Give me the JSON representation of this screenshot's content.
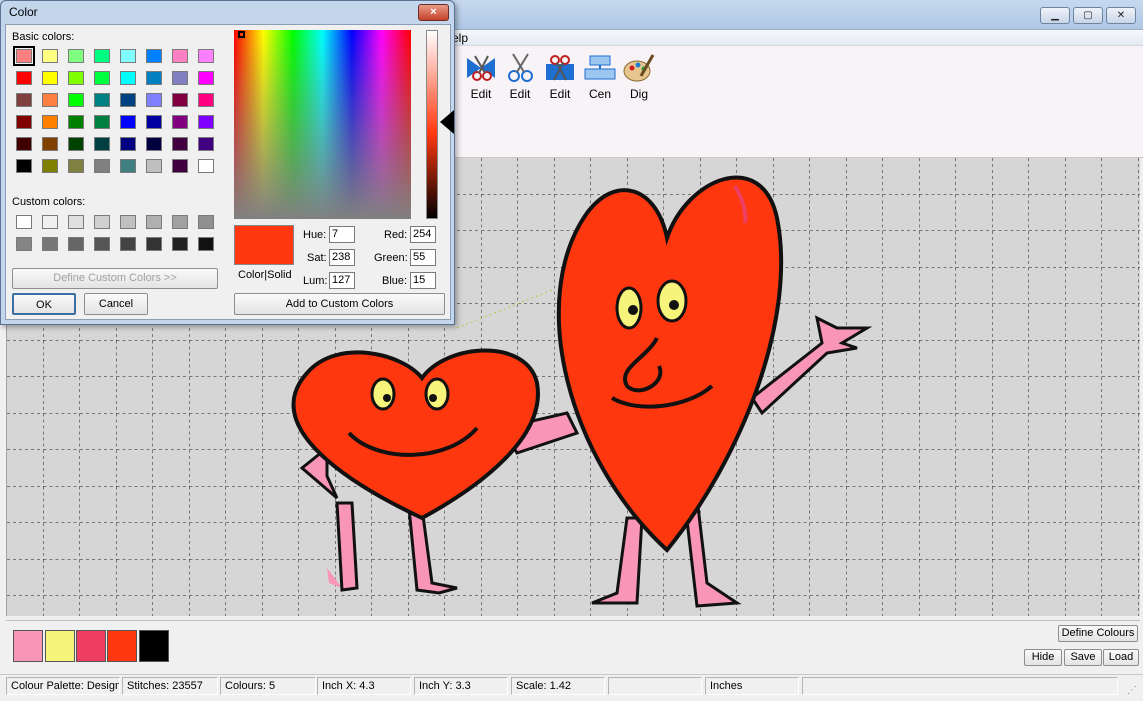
{
  "app": {
    "menu_fragment": "elp",
    "toolbar": [
      {
        "label": "Edit",
        "icon": "ribbon-scissors-icon"
      },
      {
        "label": "Edit",
        "icon": "scissors-icon"
      },
      {
        "label": "Edit",
        "icon": "scissors-ribbon-icon"
      },
      {
        "label": "Cen",
        "icon": "center-align-icon"
      },
      {
        "label": "Dig",
        "icon": "palette-brush-icon"
      }
    ]
  },
  "palette": {
    "swatches": [
      "#f996b8",
      "#f6f47a",
      "#ee3f63",
      "#fe370f",
      "#000000"
    ],
    "define_colours": "Define Colours",
    "hide": "Hide",
    "save": "Save",
    "load": "Load"
  },
  "status": {
    "palette": "Colour Palette: Design",
    "stitches": "Stitches: 23557",
    "colours": "Colours: 5",
    "inch_x": "Inch X: 4.3",
    "inch_y": "Inch Y: 3.3",
    "scale": "Scale: 1.42",
    "empty": "",
    "units": "Inches"
  },
  "dialog": {
    "title": "Color",
    "close": "×",
    "basic_colors_label": "Basic colors:",
    "custom_colors_label": "Custom colors:",
    "basic_colors": [
      "#ff8080",
      "#ffff80",
      "#80ff80",
      "#00ff80",
      "#80ffff",
      "#0080ff",
      "#ff80c0",
      "#ff80ff",
      "#ff0000",
      "#ffff00",
      "#80ff00",
      "#00ff40",
      "#00ffff",
      "#0080c0",
      "#8080c0",
      "#ff00ff",
      "#804040",
      "#ff8040",
      "#00ff00",
      "#008080",
      "#004080",
      "#8080ff",
      "#800040",
      "#ff0080",
      "#800000",
      "#ff8000",
      "#008000",
      "#008040",
      "#0000ff",
      "#0000a0",
      "#800080",
      "#8000ff",
      "#400000",
      "#804000",
      "#004000",
      "#004040",
      "#000080",
      "#000040",
      "#400040",
      "#400080",
      "#000000",
      "#808000",
      "#808040",
      "#808080",
      "#408080",
      "#c0c0c0",
      "#400040",
      "#ffffff"
    ],
    "custom_colors": [
      "#ffffff",
      "#f0f0f0",
      "#e0e0e0",
      "#d0d0d0",
      "#c0c0c0",
      "#b0b0b0",
      "#a0a0a0",
      "#909090",
      "#858585",
      "#777777",
      "#666666",
      "#555555",
      "#444444",
      "#333333",
      "#222222",
      "#111111"
    ],
    "define_custom": "Define Custom Colors >>",
    "ok": "OK",
    "cancel": "Cancel",
    "color_solid": "Color|Solid",
    "selected_color": "#fe370f",
    "hue_label": "Hue:",
    "sat_label": "Sat:",
    "lum_label": "Lum:",
    "red_label": "Red:",
    "green_label": "Green:",
    "blue_label": "Blue:",
    "hue": "7",
    "sat": "238",
    "lum": "127",
    "red": "254",
    "green": "55",
    "blue": "15",
    "add_custom": "Add to Custom Colors"
  }
}
